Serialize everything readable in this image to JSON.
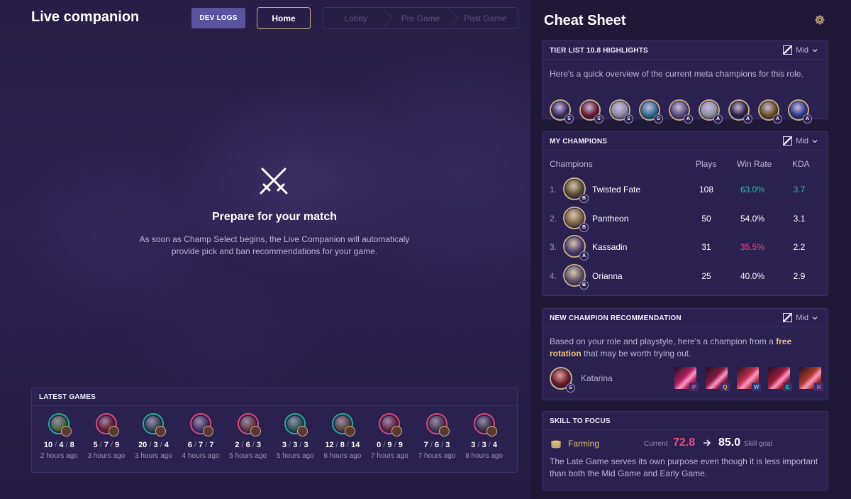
{
  "header": {
    "app_title": "Live companion",
    "dev_logs_label": "DEV LOGS",
    "home_label": "Home",
    "phases": [
      "Lobby",
      "Pre Game",
      "Post Game"
    ]
  },
  "main": {
    "icon": "crossed-swords-icon",
    "title": "Prepare for your match",
    "description": "As soon as Champ Select begins, the Live Companion will automaticaly provide pick and ban recommendations for your game."
  },
  "latest_games": {
    "title": "LATEST GAMES",
    "games": [
      {
        "k": "10",
        "d": "4",
        "a": "8",
        "ago": "2 hours ago",
        "result": "win",
        "color": "#4a6a3a"
      },
      {
        "k": "5",
        "d": "7",
        "a": "9",
        "ago": "3 hours ago",
        "result": "loss",
        "color": "#6a2230"
      },
      {
        "k": "20",
        "d": "3",
        "a": "4",
        "ago": "3 hours ago",
        "result": "win",
        "color": "#3a4a5a"
      },
      {
        "k": "6",
        "d": "7",
        "a": "7",
        "ago": "4 hours ago",
        "result": "loss",
        "color": "#4a3a6a"
      },
      {
        "k": "2",
        "d": "6",
        "a": "3",
        "ago": "5 hours ago",
        "result": "loss",
        "color": "#6a3a40"
      },
      {
        "k": "3",
        "d": "3",
        "a": "3",
        "ago": "5 hours ago",
        "result": "win",
        "color": "#2a5a50"
      },
      {
        "k": "12",
        "d": "8",
        "a": "14",
        "ago": "6 hours ago",
        "result": "win",
        "color": "#5a4a3a"
      },
      {
        "k": "0",
        "d": "9",
        "a": "9",
        "ago": "7 hours ago",
        "result": "loss",
        "color": "#6a2a40"
      },
      {
        "k": "7",
        "d": "6",
        "a": "3",
        "ago": "7 hours ago",
        "result": "loss",
        "color": "#4a4050"
      },
      {
        "k": "3",
        "d": "3",
        "a": "4",
        "ago": "8 hours ago",
        "result": "loss",
        "color": "#3a3a4a"
      }
    ]
  },
  "cheat_sheet": {
    "title": "Cheat Sheet",
    "settings_icon": "gear-icon",
    "tier_list": {
      "title": "TIER LIST 10.8 HIGHLIGHTS",
      "role": "Mid",
      "text": "Here's a quick overview of the current meta champions for this role.",
      "champions": [
        {
          "tier": "S",
          "color": "#3a2a5a"
        },
        {
          "tier": "S",
          "color": "#6a1a2a"
        },
        {
          "tier": "S",
          "color": "#8a8aa0"
        },
        {
          "tier": "S",
          "color": "#2a6a8a"
        },
        {
          "tier": "A",
          "color": "#5a4a7a"
        },
        {
          "tier": "A",
          "color": "#8a90a0"
        },
        {
          "tier": "A",
          "color": "#2a2040"
        },
        {
          "tier": "A",
          "color": "#6a5020"
        },
        {
          "tier": "A",
          "color": "#2a3a8a"
        }
      ]
    },
    "my_champions": {
      "title": "MY CHAMPIONS",
      "role": "Mid",
      "headers": {
        "champions": "Champions",
        "plays": "Plays",
        "win_rate": "Win Rate",
        "kda": "KDA"
      },
      "rows": [
        {
          "rank": "1.",
          "name": "Twisted Fate",
          "tier": "B",
          "plays": "108",
          "win_rate": "63.0%",
          "wr_status": "good",
          "kda": "3.7",
          "kda_status": "good",
          "color": "#5a4a30"
        },
        {
          "rank": "2.",
          "name": "Pantheon",
          "tier": "B",
          "plays": "50",
          "win_rate": "54.0%",
          "wr_status": "neutral",
          "kda": "3.1",
          "kda_status": "neutral",
          "color": "#7a6040"
        },
        {
          "rank": "3.",
          "name": "Kassadin",
          "tier": "A",
          "plays": "31",
          "win_rate": "35.5%",
          "wr_status": "bad",
          "kda": "2.2",
          "kda_status": "neutral",
          "color": "#4a3a6a"
        },
        {
          "rank": "4.",
          "name": "Orianna",
          "tier": "B",
          "plays": "25",
          "win_rate": "40.0%",
          "wr_status": "neutral",
          "kda": "2.9",
          "kda_status": "neutral",
          "color": "#5a5060"
        }
      ]
    },
    "recommendation": {
      "title": "NEW CHAMPION RECOMMENDATION",
      "role": "Mid",
      "text_before": "Based on your role and playstyle, here's a champion from a ",
      "highlight": "free rotation",
      "text_after": " that may be worth trying out.",
      "champion": {
        "name": "Katarina",
        "tier": "S",
        "color": "#6a1a2a"
      },
      "skills": [
        {
          "key": "P",
          "color": "#b02060"
        },
        {
          "key": "Q",
          "color": "#8a1a40"
        },
        {
          "key": "W",
          "color": "#c0304a"
        },
        {
          "key": "E",
          "color": "#a01a3a"
        },
        {
          "key": "R",
          "color": "#b03a2a"
        }
      ]
    },
    "skill_focus": {
      "title": "SKILL TO FOCUS",
      "skill": "Farming",
      "icon": "coins-icon",
      "current_label": "Current",
      "current_value": "72.8",
      "goal_value": "85.0",
      "goal_label": "Skill goal",
      "text": "The Late Game serves its own purpose even though it is less important than both the Mid Game and Early Game."
    }
  },
  "colors": {
    "accent": "#5a54a0",
    "gold": "#c8ad84",
    "win": "#1ab394",
    "loss": "#e2467a",
    "good": "#1fc9a0",
    "bad": "#ef4a82"
  }
}
